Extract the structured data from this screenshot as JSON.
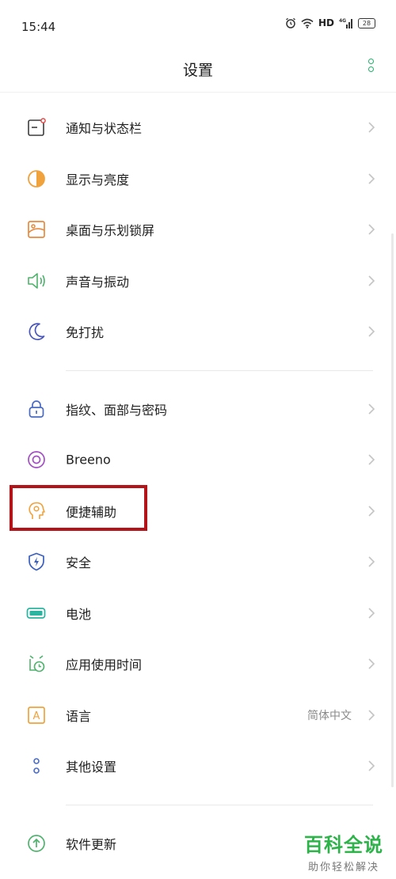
{
  "status_bar": {
    "time": "15:44",
    "hd": "HD",
    "signal": "4G",
    "battery": "28"
  },
  "header": {
    "title": "设置"
  },
  "colors": {
    "accent_green": "#21b26b",
    "highlight_red": "#b3141a",
    "chevron": "#c4c4c4"
  },
  "groups": [
    {
      "items": [
        {
          "label": "通知与状态栏",
          "icon": "notification-icon"
        },
        {
          "label": "显示与亮度",
          "icon": "brightness-icon"
        },
        {
          "label": "桌面与乐划锁屏",
          "icon": "wallpaper-icon"
        },
        {
          "label": "声音与振动",
          "icon": "speaker-icon"
        },
        {
          "label": "免打扰",
          "icon": "moon-icon"
        }
      ]
    },
    {
      "items": [
        {
          "label": "指纹、面部与密码",
          "icon": "lock-icon"
        },
        {
          "label": "Breeno",
          "icon": "breeno-icon"
        },
        {
          "label": "便捷辅助",
          "icon": "assist-icon"
        },
        {
          "label": "安全",
          "icon": "shield-icon"
        },
        {
          "label": "电池",
          "icon": "battery-icon"
        },
        {
          "label": "应用使用时间",
          "icon": "app-time-icon"
        },
        {
          "label": "语言",
          "icon": "language-icon",
          "value": "简体中文"
        },
        {
          "label": "其他设置",
          "icon": "more-settings-icon"
        }
      ]
    },
    {
      "items": [
        {
          "label": "软件更新",
          "icon": "update-icon"
        }
      ]
    }
  ],
  "watermark": {
    "title": "百科全说",
    "subtitle": "助你轻松解决"
  }
}
